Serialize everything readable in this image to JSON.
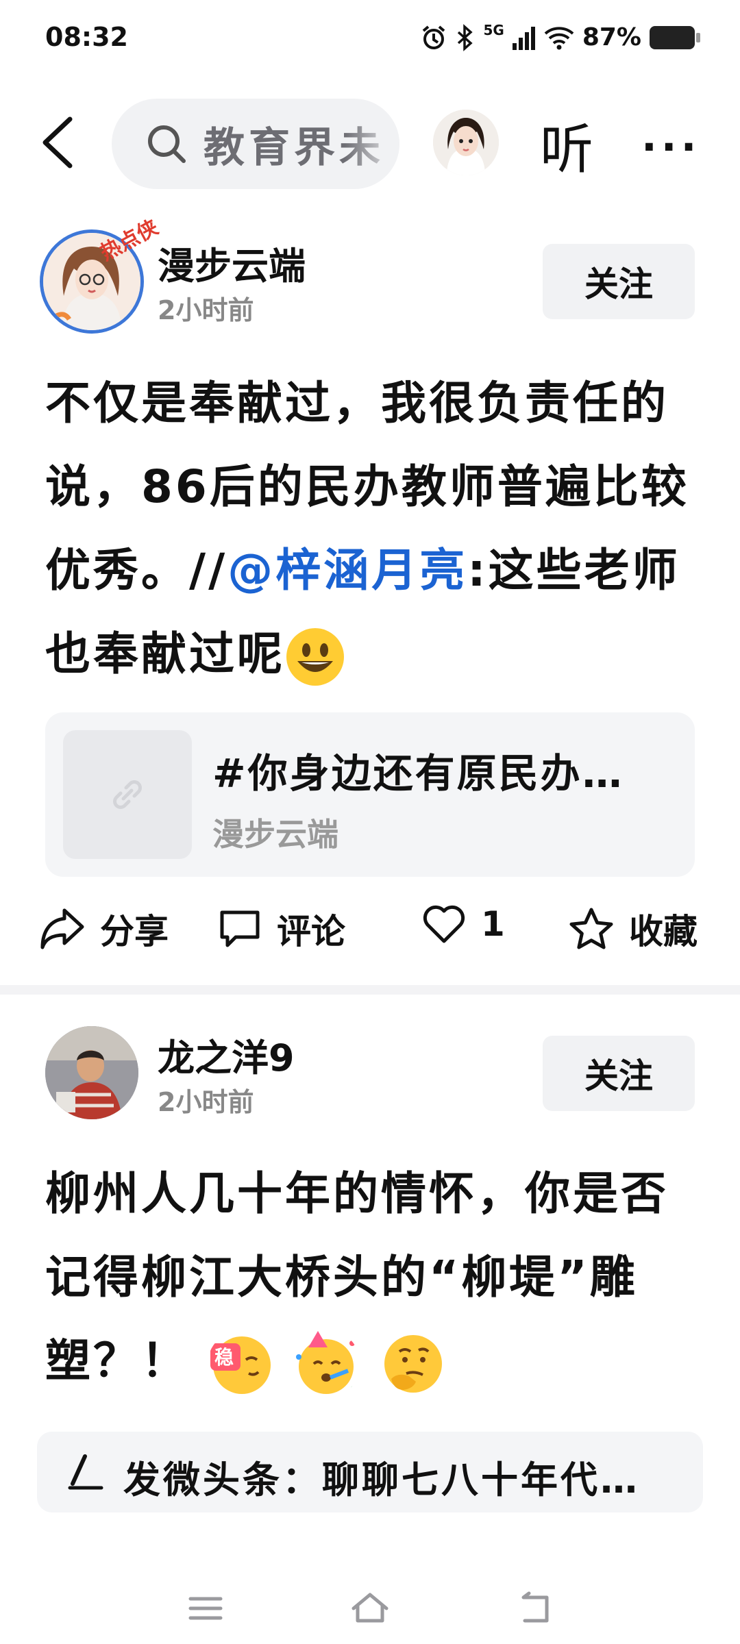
{
  "status_bar": {
    "time": "08:32",
    "network": "5G",
    "battery": "87%"
  },
  "header": {
    "search_text": "教育界未",
    "listen_label": "听",
    "more_label": "···"
  },
  "posts": [
    {
      "author": "漫步云端",
      "time": "2小时前",
      "avatar_badge": "热点侠",
      "follow_label": "关注",
      "text_before": "不仅是奉献过，我很负责任的说，86后的民办教师普遍比较优秀。//",
      "mention": "@梓涵月亮",
      "text_after": ":这些老师也奉献过呢",
      "emoji": "grinning-face",
      "link_card": {
        "title": "#你身边还有原民办…",
        "source": "漫步云端"
      },
      "actions": {
        "share": "分享",
        "comment": "评论",
        "likes": "1",
        "favorite": "收藏"
      }
    },
    {
      "author": "龙之洋9",
      "time": "2小时前",
      "follow_label": "关注",
      "text": "柳州人几十年的情怀，你是否记得柳江大桥头的“柳堤”雕塑？！",
      "emojis": [
        "steady-emoji",
        "party-face-emoji",
        "thinking-face-emoji"
      ],
      "emoji_badge": "稳"
    }
  ],
  "compose": {
    "text": "发微头条：聊聊七八十年代…"
  },
  "colors": {
    "mention": "#1b63d2",
    "button_bg": "#f1f2f4",
    "card_bg": "#f4f5f7"
  }
}
